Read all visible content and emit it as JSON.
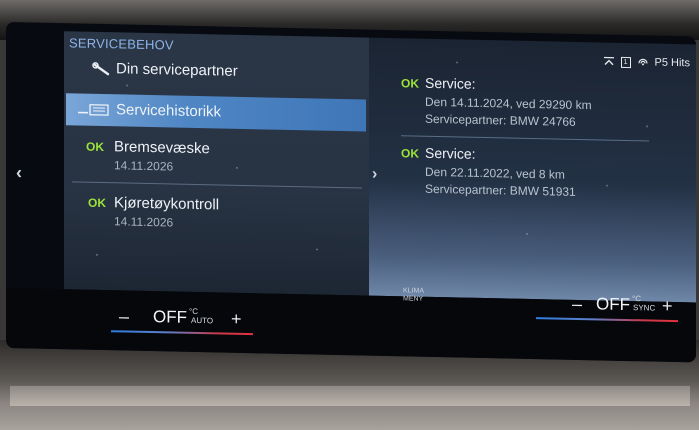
{
  "header": {
    "title": "SERVICEBEHOV"
  },
  "menu": {
    "service_partner": {
      "label": "Din servicepartner",
      "icon": "wrench-icon"
    },
    "service_history": {
      "label": "Servicehistorikk",
      "icon": "service-history-icon"
    },
    "brake_fluid": {
      "status": "OK",
      "label": "Bremsevæske",
      "date": "14.11.2026"
    },
    "vehicle_check": {
      "status": "OK",
      "label": "Kjøretøykontroll",
      "date": "14.11.2026"
    }
  },
  "status_bar": {
    "radio": "P5 Hits",
    "badge": "1"
  },
  "services": [
    {
      "status": "OK",
      "title": "Service:",
      "detail": "Den 14.11.2024, ved 29290 km",
      "partner": "Servicepartner: BMW 24766"
    },
    {
      "status": "OK",
      "title": "Service:",
      "detail": "Den 22.11.2022, ved 8 km",
      "partner": "Servicepartner: BMW 51931"
    }
  ],
  "climate": {
    "left": {
      "minus": "–",
      "value": "OFF",
      "unit": "°C",
      "mode": "AUTO",
      "plus": "+"
    },
    "right": {
      "minus": "–",
      "value": "OFF",
      "unit": "°C",
      "mode": "SYNC",
      "plus": "+"
    },
    "klima_label_1": "KLIMA",
    "klima_label_2": "MENY"
  },
  "colors": {
    "accent_blue": "#4f86c4",
    "ok_green": "#9be23a",
    "header_blue": "#8db4e6"
  }
}
